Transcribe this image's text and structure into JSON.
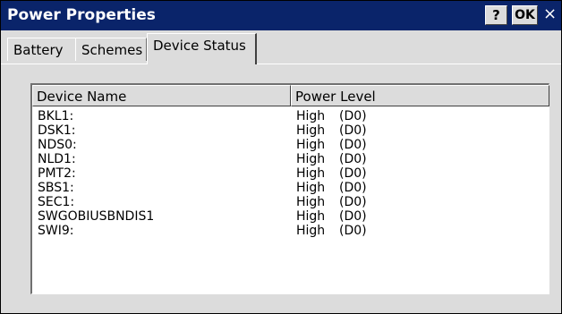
{
  "window": {
    "title": "Power Properties",
    "help_label": "?",
    "ok_label": "OK",
    "close_label": "×"
  },
  "tabs": [
    {
      "label": "Battery"
    },
    {
      "label": "Schemes"
    },
    {
      "label": "Device Status"
    }
  ],
  "table": {
    "columns": [
      "Device Name",
      "Power Level"
    ],
    "rows": [
      {
        "name": "BKL1:",
        "level": "High",
        "state": "(D0)"
      },
      {
        "name": "DSK1:",
        "level": "High",
        "state": "(D0)"
      },
      {
        "name": "NDS0:",
        "level": "High",
        "state": "(D0)"
      },
      {
        "name": "NLD1:",
        "level": "High",
        "state": "(D0)"
      },
      {
        "name": "PMT2:",
        "level": "High",
        "state": "(D0)"
      },
      {
        "name": "SBS1:",
        "level": "High",
        "state": "(D0)"
      },
      {
        "name": "SEC1:",
        "level": "High",
        "state": "(D0)"
      },
      {
        "name": "SWGOBIUSBNDIS1",
        "level": "High",
        "state": "(D0)"
      },
      {
        "name": "SWI9:",
        "level": "High",
        "state": "(D0)"
      }
    ]
  },
  "colors": {
    "titlebar": "#0a246a",
    "face": "#dcdcdc",
    "list_background": "#ffffff"
  }
}
